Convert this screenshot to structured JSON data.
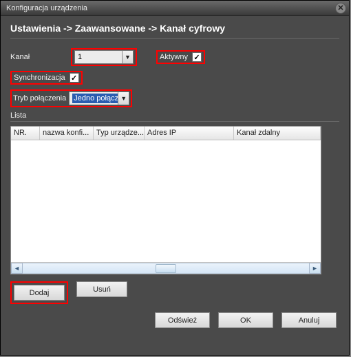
{
  "window": {
    "title": "Konfiguracja urządzenia"
  },
  "breadcrumb": "Ustawienia -> Zaawansowane -> Kanał cyfrowy",
  "fields": {
    "channel_label": "Kanał",
    "channel_value": "1",
    "active_label": "Aktywny",
    "active_checked": "☑",
    "sync_label": "Synchronizacja",
    "sync_checked": "☑",
    "connmode_label": "Tryb połączenia",
    "connmode_value": "Jedno połącz"
  },
  "list": {
    "label": "Lista",
    "columns": {
      "nr": "NR.",
      "config_name": "nazwa konfi...",
      "device_type": "Typ urządze...",
      "ip": "Adres IP",
      "remote_channel": "Kanał zdalny"
    }
  },
  "buttons": {
    "add": "Dodaj",
    "delete": "Usuń",
    "refresh": "Odśwież",
    "ok": "OK",
    "cancel": "Anuluj"
  }
}
